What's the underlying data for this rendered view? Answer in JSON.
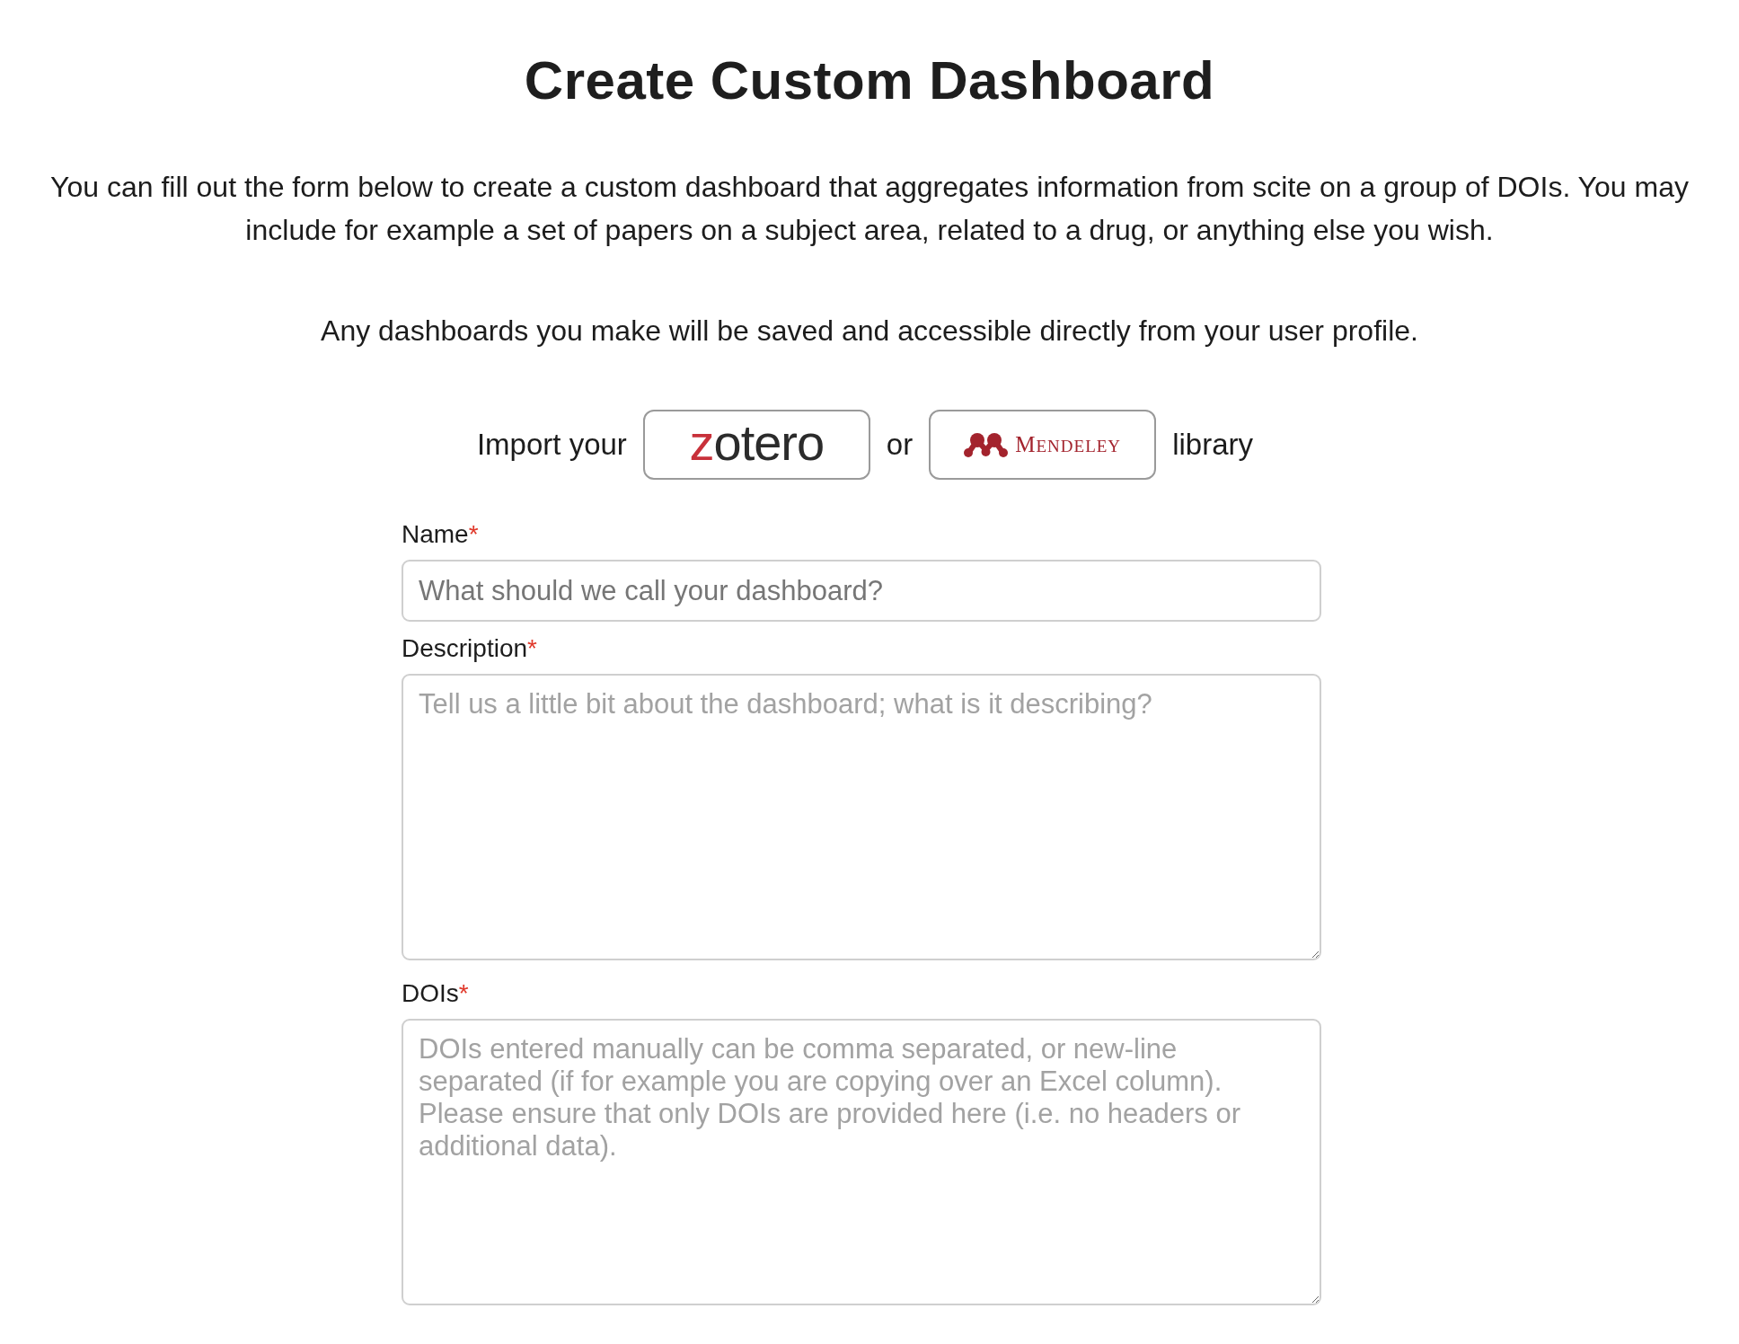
{
  "page": {
    "title": "Create Custom Dashboard",
    "intro": [
      "You can fill out the form below to create a custom dashboard that aggregates information from scite on a group of DOIs. You may include for example a set of papers on a subject area, related to a drug, or anything else you wish.",
      "Any dashboards you make will be saved and accessible directly from your user profile."
    ]
  },
  "import": {
    "lead": "Import your",
    "connector": "or",
    "trail": "library",
    "sources": [
      {
        "kind": "zotero",
        "label": "zotero"
      },
      {
        "kind": "mendeley",
        "label": "MENDELEY"
      }
    ]
  },
  "form": {
    "fields": [
      {
        "kind": "input",
        "label": "Name",
        "required_mark": "*",
        "placeholder": "What should we call your dashboard?"
      },
      {
        "kind": "textarea",
        "label": "Description",
        "required_mark": "*",
        "placeholder": "Tell us a little bit about the dashboard; what is it describing?"
      },
      {
        "kind": "textarea",
        "label": "DOIs",
        "required_mark": "*",
        "placeholder": "DOIs entered manually can be comma separated, or new-line separated (if for example you are copying over an Excel column). Please ensure that only DOIs are provided here (i.e. no headers or additional data)."
      }
    ]
  }
}
